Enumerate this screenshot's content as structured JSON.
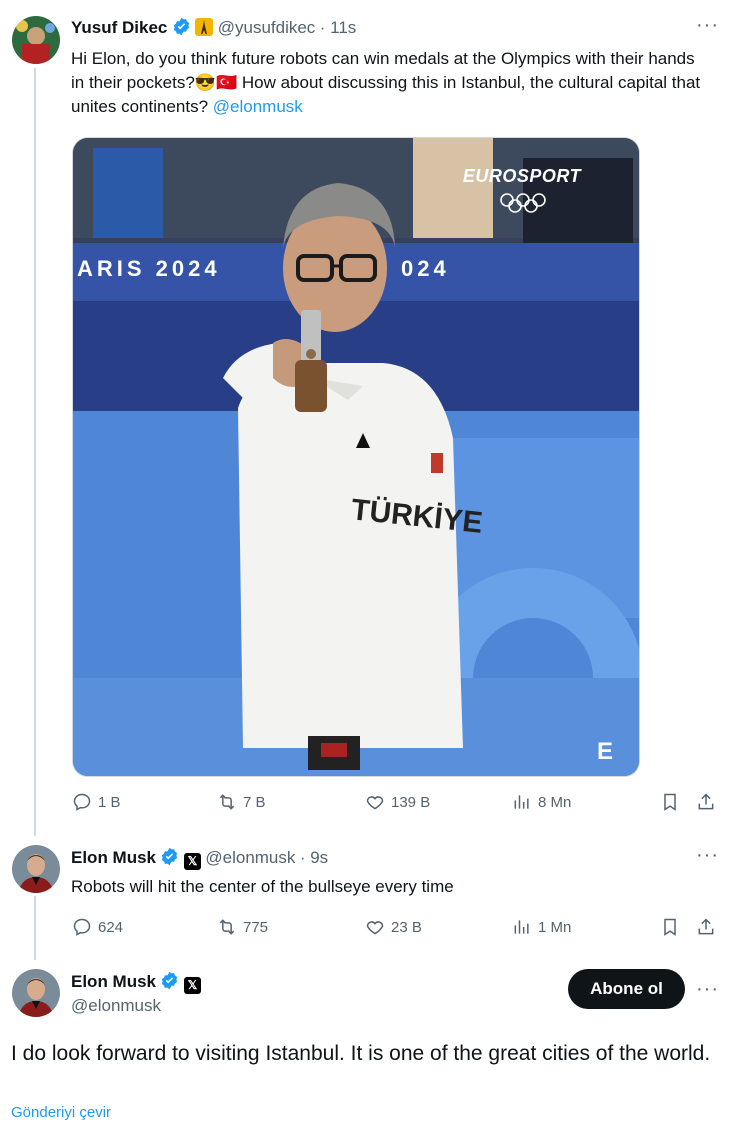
{
  "tweet1": {
    "name": "Yusuf Dikec",
    "handle": "@yusufdikec",
    "time": "· 11s",
    "text_part1": "Hi Elon, do you think future robots can win medals at the Olympics with their hands in their pockets?😎🇹🇷 How about discussing this in Istanbul, the cultural capital that unites continents? ",
    "mention": "@elonmusk",
    "media": {
      "watermark": "EUROSPORT",
      "banner_left": "ARIS 2024",
      "banner_right": "024",
      "shirt_text": "TÜRKİYE",
      "corner_logo": "E"
    },
    "stats": {
      "replies": "1 B",
      "reposts": "7 B",
      "likes": "139 B",
      "views": "8 Mn"
    }
  },
  "tweet2": {
    "name": "Elon Musk",
    "handle": "@elonmusk",
    "time": "· 9s",
    "text": "Robots will hit the center of the bullseye every time",
    "stats": {
      "replies": "624",
      "reposts": "775",
      "likes": "23 B",
      "views": "1 Mn"
    }
  },
  "tweet3": {
    "name": "Elon Musk",
    "handle": "@elonmusk",
    "follow_label": "Abone ol",
    "text": "I do look forward to visiting Istanbul. It is one of the great cities of the world.",
    "translate_label": "Gönderiyi çevir"
  },
  "colors": {
    "accent": "#1d9bf0",
    "text": "#0f1419",
    "muted": "#536471",
    "border": "#cfd9de"
  }
}
